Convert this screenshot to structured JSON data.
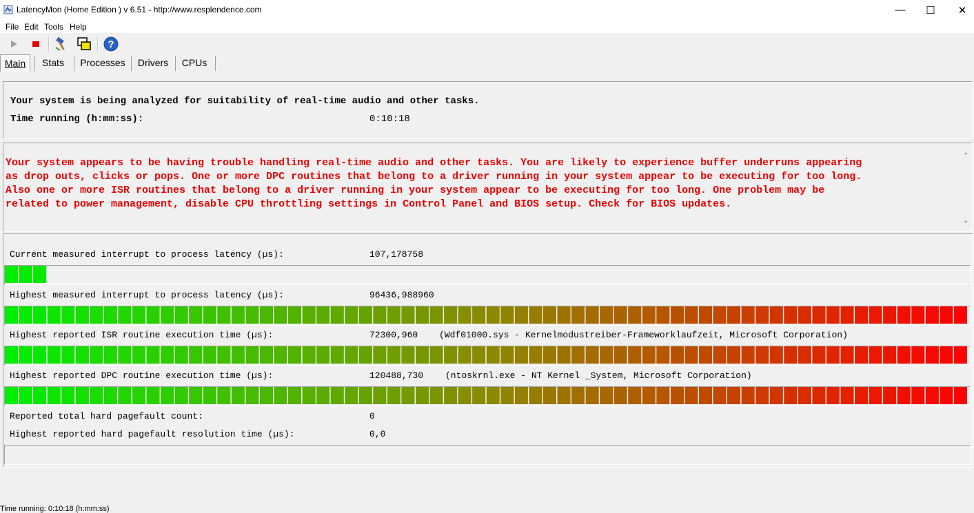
{
  "window": {
    "title": "LatencyMon  (Home Edition )  v 6.51 - http://www.resplendence.com",
    "minimize_glyph": "—",
    "maximize_glyph": "☐",
    "close_glyph": "✕"
  },
  "menu": [
    "File",
    "Edit",
    "Tools",
    "Help"
  ],
  "toolbar": {
    "icons": [
      "play-icon",
      "stop-icon",
      "hammer-icon",
      "windows-icon",
      "help-icon"
    ],
    "help_glyph": "?"
  },
  "tabs": [
    "Main",
    "Stats",
    "Processes",
    "Drivers",
    "CPUs"
  ],
  "analysis": {
    "status_line": "Your system is being analyzed for suitability of real-time audio and other tasks.",
    "time_label": "Time running (h:mm:ss):",
    "time_value": "0:10:18"
  },
  "conclusion": {
    "lines": [
      "Your system appears to be having trouble handling real-time audio and other tasks. You are likely to experience buffer underruns appearing",
      "as drop outs, clicks or pops. One or more DPC routines that belong to a driver running in your system appear to be executing for too long.",
      "Also one or more ISR routines that belong to a driver running in your system appear to be executing for too long. One problem may be",
      "related to power management, disable CPU throttling settings in Control Panel and BIOS setup. Check for BIOS updates."
    ],
    "scroll_up": "⌃",
    "scroll_down": "⌄"
  },
  "measurements": {
    "current_label": "Current measured interrupt to process latency (µs):",
    "current_value": "107,178758",
    "current_fill": 0.03,
    "highest_label": "Highest measured interrupt to process latency (µs):",
    "highest_value": "96436,988960",
    "highest_fill": 1.0,
    "isr_label": "Highest reported ISR routine execution time (µs):",
    "isr_value": "72300,960",
    "isr_driver": "(Wdf01000.sys - Kernelmodustreiber-Frameworklaufzeit, Microsoft Corporation)",
    "isr_fill": 1.0,
    "dpc_label": "Highest reported DPC routine execution time (µs):",
    "dpc_value": "120488,730",
    "dpc_driver": "(ntoskrnl.exe - NT Kernel _System, Microsoft Corporation)",
    "dpc_fill": 1.0,
    "pagefault_count_label": "Reported total hard pagefault count:",
    "pagefault_count_value": "0",
    "pagefault_time_label": "Highest reported hard pagefault resolution time (µs):",
    "pagefault_time_value": "0,0",
    "pagefault_fill": 0.0
  },
  "colors": {
    "bar_start": "#00ee00",
    "bar_mid": "#8a8a00",
    "bar_end": "#ff0000",
    "warning_text": "#e80000"
  },
  "status_bar": "Time running: 0:10:18  (h:mm:ss)"
}
